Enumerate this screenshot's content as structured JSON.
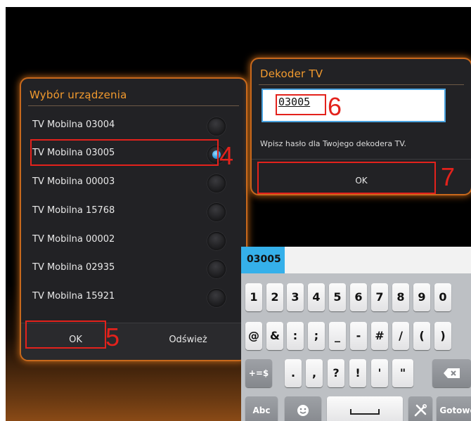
{
  "device_dialog": {
    "title": "Wybór urządzenia",
    "items": [
      {
        "label": "TV Mobilna 03004",
        "selected": false
      },
      {
        "label": "TV Mobilna 03005",
        "selected": true
      },
      {
        "label": "TV Mobilna 00003",
        "selected": false
      },
      {
        "label": "TV Mobilna 15768",
        "selected": false
      },
      {
        "label": "TV Mobilna 00002",
        "selected": false
      },
      {
        "label": "TV Mobilna 02935",
        "selected": false
      },
      {
        "label": "TV Mobilna 15921",
        "selected": false
      }
    ],
    "ok_label": "OK",
    "refresh_label": "Odśwież"
  },
  "decoder_dialog": {
    "title": "Dekoder TV",
    "password_value": "03005",
    "hint": "Wpisz hasło dla Twojego dekodera TV.",
    "ok_label": "OK"
  },
  "annotations": {
    "n4": "4",
    "n5": "5",
    "n6": "6",
    "n7": "7"
  },
  "keyboard": {
    "suggestion": "03005",
    "row1": [
      "1",
      "2",
      "3",
      "4",
      "5",
      "6",
      "7",
      "8",
      "9",
      "0"
    ],
    "row2": [
      "@",
      "&",
      ":",
      ";",
      "_",
      "-",
      "#",
      "/",
      "(",
      ")"
    ],
    "row3": {
      "sym": "+=$",
      "keys": [
        ".",
        ",",
        "?",
        "!",
        "'",
        "\""
      ],
      "backspace_icon": "backspace-icon"
    },
    "row4": {
      "abc": "Abc",
      "emoji_icon": "smiley-icon",
      "space_icon": "space-icon",
      "settings_icon": "tools-icon",
      "done": "Gotowe"
    }
  },
  "colors": {
    "accent_orange": "#f29a2e",
    "annotation_red": "#e3221c",
    "selection_blue": "#2a9be0"
  }
}
